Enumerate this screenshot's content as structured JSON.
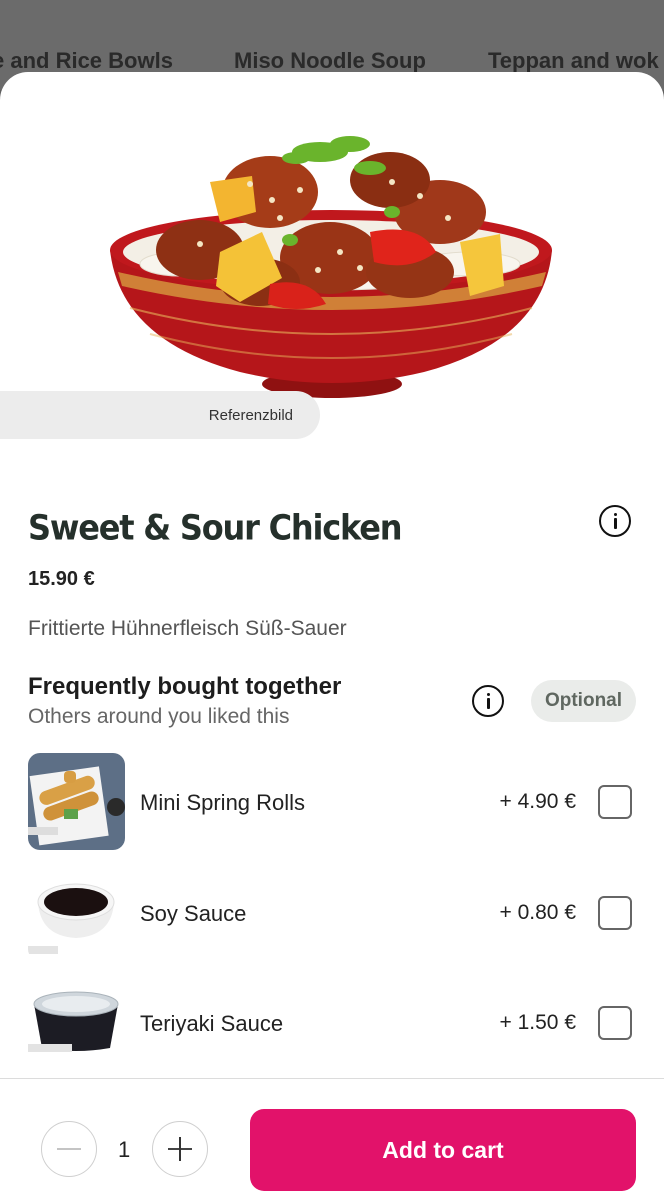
{
  "category_tabs": [
    {
      "label": "e and Rice Bowls"
    },
    {
      "label": "Miso Noodle Soup"
    },
    {
      "label": "Teppan and wok"
    }
  ],
  "product": {
    "image_badge": "Referenzbild",
    "title": "Sweet & Sour Chicken",
    "price": "15.90 €",
    "description": "Frittierte Hühnerfleisch Süß-Sauer"
  },
  "upsell": {
    "title": "Frequently bought together",
    "subtitle": "Others around you liked this",
    "badge": "Optional",
    "items": [
      {
        "name": "Mini Spring Rolls",
        "price": "+ 4.90 €",
        "checked": false
      },
      {
        "name": "Soy Sauce",
        "price": "+ 0.80 €",
        "checked": false
      },
      {
        "name": "Teriyaki Sauce",
        "price": "+ 1.50 €",
        "checked": false
      }
    ]
  },
  "footer": {
    "quantity": "1",
    "add_label": "Add to cart"
  },
  "icons": {
    "info": "info-icon",
    "minus": "minus-icon",
    "plus": "plus-icon"
  },
  "colors": {
    "accent": "#e2126a",
    "title": "#25302b",
    "overlay": "#5f5f5f"
  }
}
